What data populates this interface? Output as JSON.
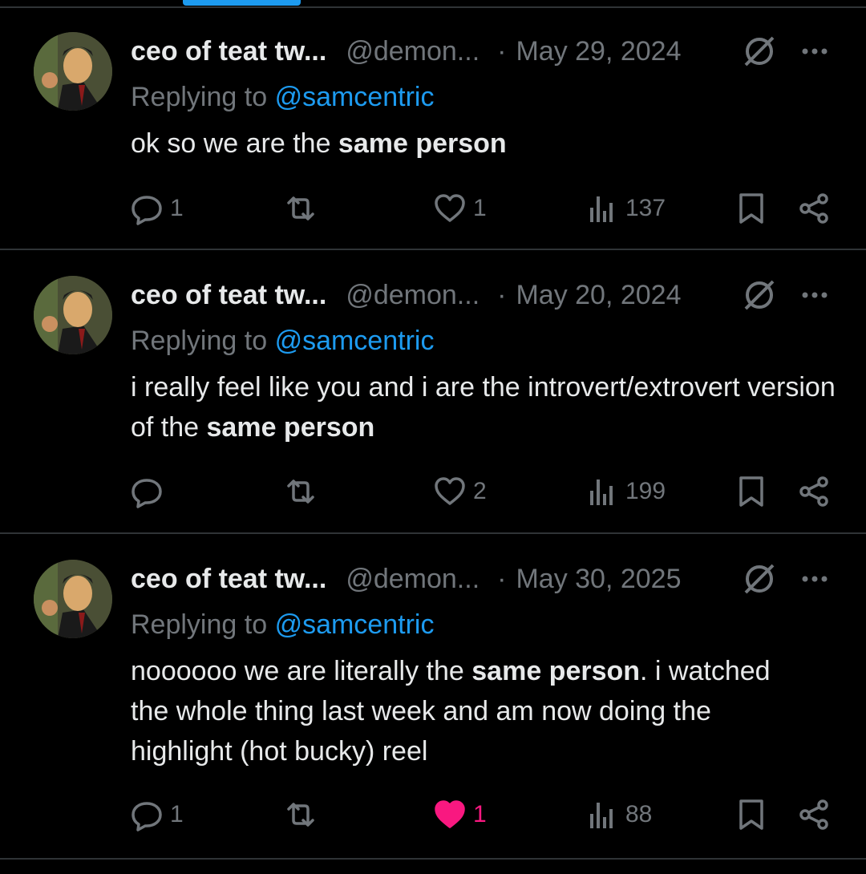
{
  "tweets": [
    {
      "name": "ceo of teat tw...",
      "handle": "@demon...",
      "separator": "·",
      "date": "May 29, 2024",
      "replying_prefix": "Replying to",
      "replying_to": "@samcentric",
      "text_parts": [
        "ok so we are the ",
        "same person",
        ""
      ],
      "replies": "1",
      "retweets": "",
      "likes": "1",
      "liked": false,
      "views": "137"
    },
    {
      "name": "ceo of teat tw...",
      "handle": "@demon...",
      "separator": "·",
      "date": "May 20, 2024",
      "replying_prefix": "Replying to",
      "replying_to": "@samcentric",
      "text_parts": [
        "i really feel like you and i are the introvert/extrovert version of the ",
        "same person",
        ""
      ],
      "replies": "",
      "retweets": "",
      "likes": "2",
      "liked": false,
      "views": "199"
    },
    {
      "name": "ceo of teat tw...",
      "handle": "@demon...",
      "separator": "·",
      "date": "May 30, 2025",
      "replying_prefix": "Replying to",
      "replying_to": "@samcentric",
      "text_parts": [
        "noooooo we are literally the ",
        "same person",
        ". i watched the whole thing last week and am now doing the highlight (hot bucky) reel"
      ],
      "replies": "1",
      "retweets": "",
      "likes": "1",
      "liked": true,
      "views": "88"
    }
  ],
  "colors": {
    "background": "#000000",
    "text": "#e7e9ea",
    "muted": "#71767b",
    "accent": "#1d9bf0",
    "like": "#f91880",
    "divider": "#2f3336"
  },
  "icons": {
    "reply": "speech-bubble-icon",
    "retweet": "retweet-icon",
    "like": "heart-icon",
    "views": "bar-chart-icon",
    "bookmark": "bookmark-icon",
    "share": "share-icon",
    "label": "no-entry-icon",
    "more": "more-icon"
  }
}
